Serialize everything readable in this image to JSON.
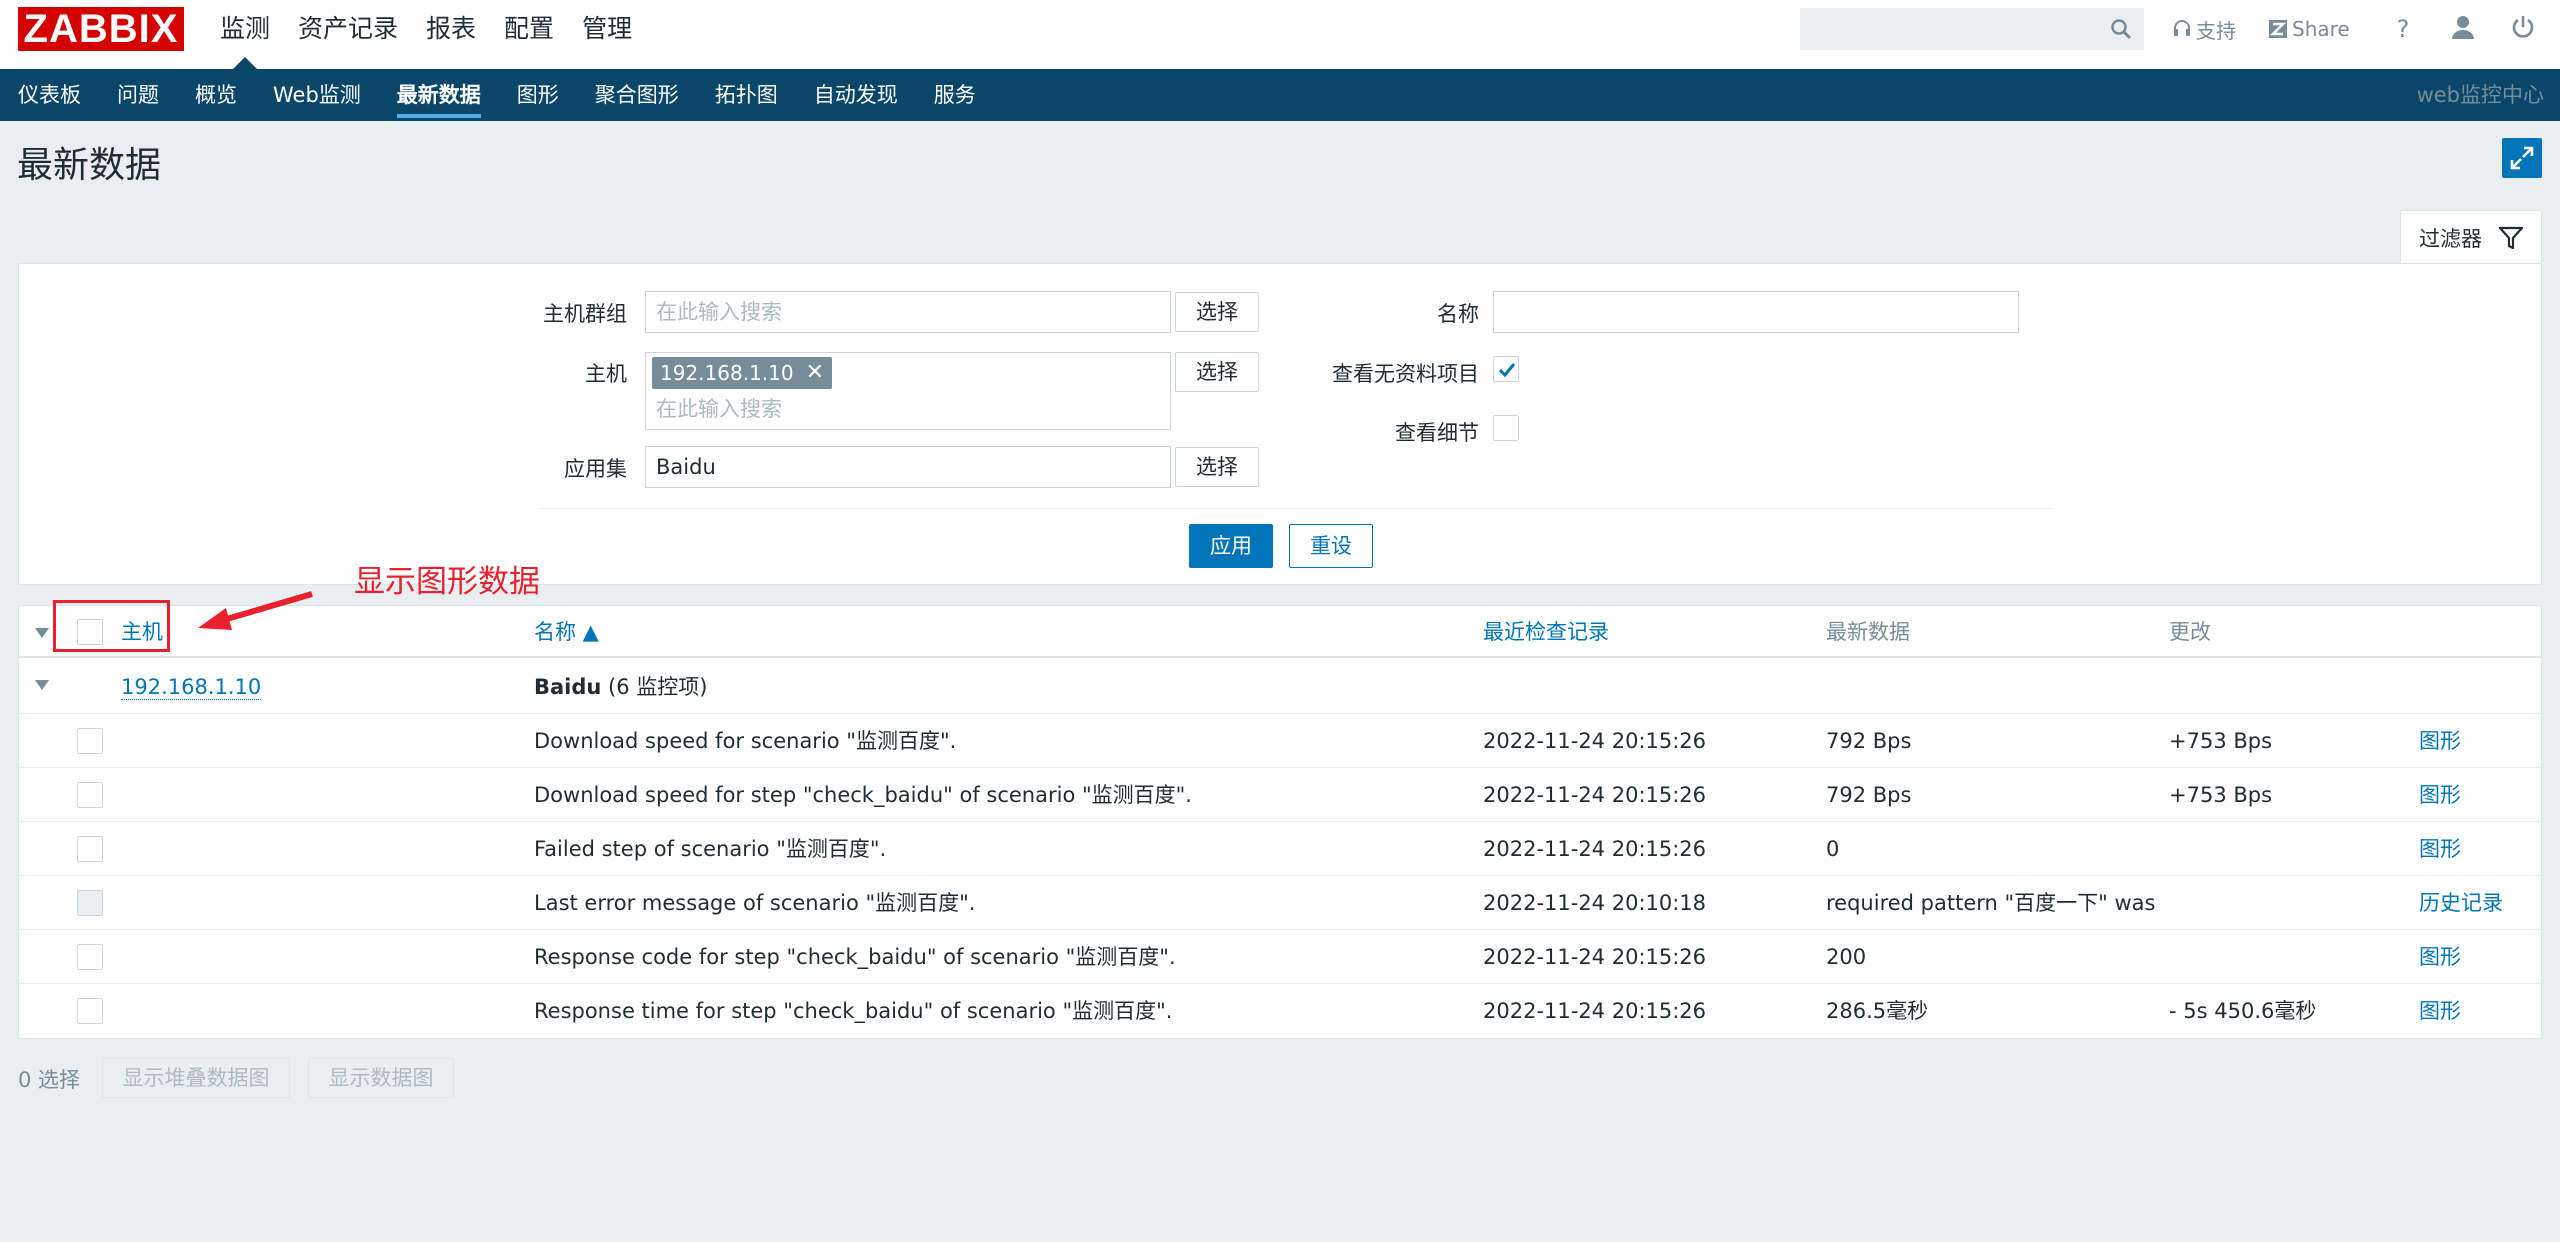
{
  "brand": {
    "logo_text": "ZABBIX",
    "logo_color": "#d40000"
  },
  "main_menu": [
    "监测",
    "资产记录",
    "报表",
    "配置",
    "管理"
  ],
  "main_menu_active": "监测",
  "top_links": {
    "support": "支持",
    "share": "Share",
    "help": "?"
  },
  "sub_menu": [
    "仪表板",
    "问题",
    "概览",
    "Web监测",
    "最新数据",
    "图形",
    "聚合图形",
    "拓扑图",
    "自动发现",
    "服务"
  ],
  "sub_menu_active": "最新数据",
  "server_name": "web监控中心",
  "page_title": "最新数据",
  "filter": {
    "tab_label": "过滤器",
    "host_groups_label": "主机群组",
    "host_groups_placeholder": "在此输入搜索",
    "hosts_label": "主机",
    "host_tag": "192.168.1.10",
    "hosts_placeholder": "在此输入搜索",
    "application_label": "应用集",
    "application_value": "Baidu",
    "select_label": "选择",
    "name_label": "名称",
    "name_value": "",
    "show_without_data_label": "查看无资料项目",
    "show_without_data_checked": true,
    "show_details_label": "查看细节",
    "show_details_checked": false,
    "apply_label": "应用",
    "reset_label": "重设"
  },
  "annotation": {
    "text": "显示图形数据",
    "color": "#e8212d"
  },
  "table": {
    "headers": {
      "host": "主机",
      "name": "名称 ▲",
      "last_check": "最近检查记录",
      "last_value": "最新数据",
      "change": "更改"
    },
    "group": {
      "host": "192.168.1.10",
      "app": "Baidu",
      "count": "(6 监控项)"
    },
    "rows": [
      {
        "name": "Download speed for scenario \"监测百度\".",
        "last_check": "2022-11-24 20:15:26",
        "last_value": "792 Bps",
        "change": "+753 Bps",
        "action": "图形",
        "checkbox_enabled": true
      },
      {
        "name": "Download speed for step \"check_baidu\" of scenario \"监测百度\".",
        "last_check": "2022-11-24 20:15:26",
        "last_value": "792 Bps",
        "change": "+753 Bps",
        "action": "图形",
        "checkbox_enabled": true
      },
      {
        "name": "Failed step of scenario \"监测百度\".",
        "last_check": "2022-11-24 20:15:26",
        "last_value": "0",
        "change": "",
        "action": "图形",
        "checkbox_enabled": true
      },
      {
        "name": "Last error message of scenario \"监测百度\".",
        "last_check": "2022-11-24 20:10:18",
        "last_value": "required pattern \"百度一下\" was …",
        "change": "",
        "action": "历史记录",
        "checkbox_enabled": false
      },
      {
        "name": "Response code for step \"check_baidu\" of scenario \"监测百度\".",
        "last_check": "2022-11-24 20:15:26",
        "last_value": "200",
        "change": "",
        "action": "图形",
        "checkbox_enabled": true
      },
      {
        "name": "Response time for step \"check_baidu\" of scenario \"监测百度\".",
        "last_check": "2022-11-24 20:15:26",
        "last_value": "286.5毫秒",
        "change": "- 5s 450.6毫秒",
        "action": "图形",
        "checkbox_enabled": true
      }
    ]
  },
  "footer": {
    "selected": "0 选择",
    "stacked_graph_btn": "显示堆叠数据图",
    "graph_btn": "显示数据图"
  }
}
